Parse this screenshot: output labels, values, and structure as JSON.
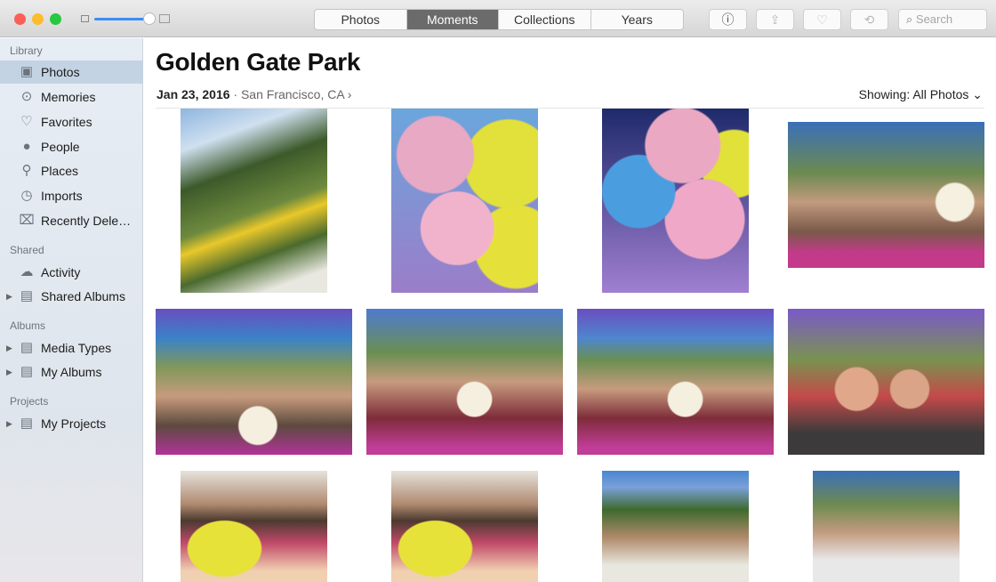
{
  "window": {
    "traffic_lights": {
      "close": "#fc5f57",
      "minimize": "#fdbc2e",
      "zoom": "#28c840"
    },
    "zoom_slider_level": 0.9
  },
  "toolbar": {
    "tabs": [
      {
        "label": "Photos",
        "active": false
      },
      {
        "label": "Moments",
        "active": true
      },
      {
        "label": "Collections",
        "active": false
      },
      {
        "label": "Years",
        "active": false
      }
    ],
    "info_icon": "ⓘ",
    "share_icon": "⇪",
    "favorite_icon": "♡",
    "rotate_icon": "⟲",
    "search_placeholder": "Search"
  },
  "sidebar": {
    "library_header": "Library",
    "library": [
      {
        "label": "Photos",
        "icon": "photos-icon",
        "glyph": "▣",
        "selected": true
      },
      {
        "label": "Memories",
        "icon": "memories-icon",
        "glyph": "⊙"
      },
      {
        "label": "Favorites",
        "icon": "heart-icon",
        "glyph": "♡"
      },
      {
        "label": "People",
        "icon": "person-icon",
        "glyph": "👤"
      },
      {
        "label": "Places",
        "icon": "pin-icon",
        "glyph": "📍"
      },
      {
        "label": "Imports",
        "icon": "clock-icon",
        "glyph": "◷"
      },
      {
        "label": "Recently Dele…",
        "icon": "trash-icon",
        "glyph": "🗑"
      }
    ],
    "shared_header": "Shared",
    "shared": [
      {
        "label": "Activity",
        "icon": "cloud-icon",
        "glyph": "☁"
      },
      {
        "label": "Shared Albums",
        "icon": "album-icon",
        "glyph": "▤"
      }
    ],
    "albums_header": "Albums",
    "albums": [
      {
        "label": "Media Types",
        "glyph": "▤"
      },
      {
        "label": "My Albums",
        "glyph": "▤"
      }
    ],
    "projects_header": "Projects",
    "projects": [
      {
        "label": "My Projects",
        "glyph": "▤"
      }
    ]
  },
  "main": {
    "title": "Golden Gate Park",
    "date": "Jan 23, 2016",
    "separator": "·",
    "location": "San Francisco, CA",
    "location_chevron": "›",
    "showing_label": "Showing: All Photos",
    "showing_chevron": "⌄"
  }
}
